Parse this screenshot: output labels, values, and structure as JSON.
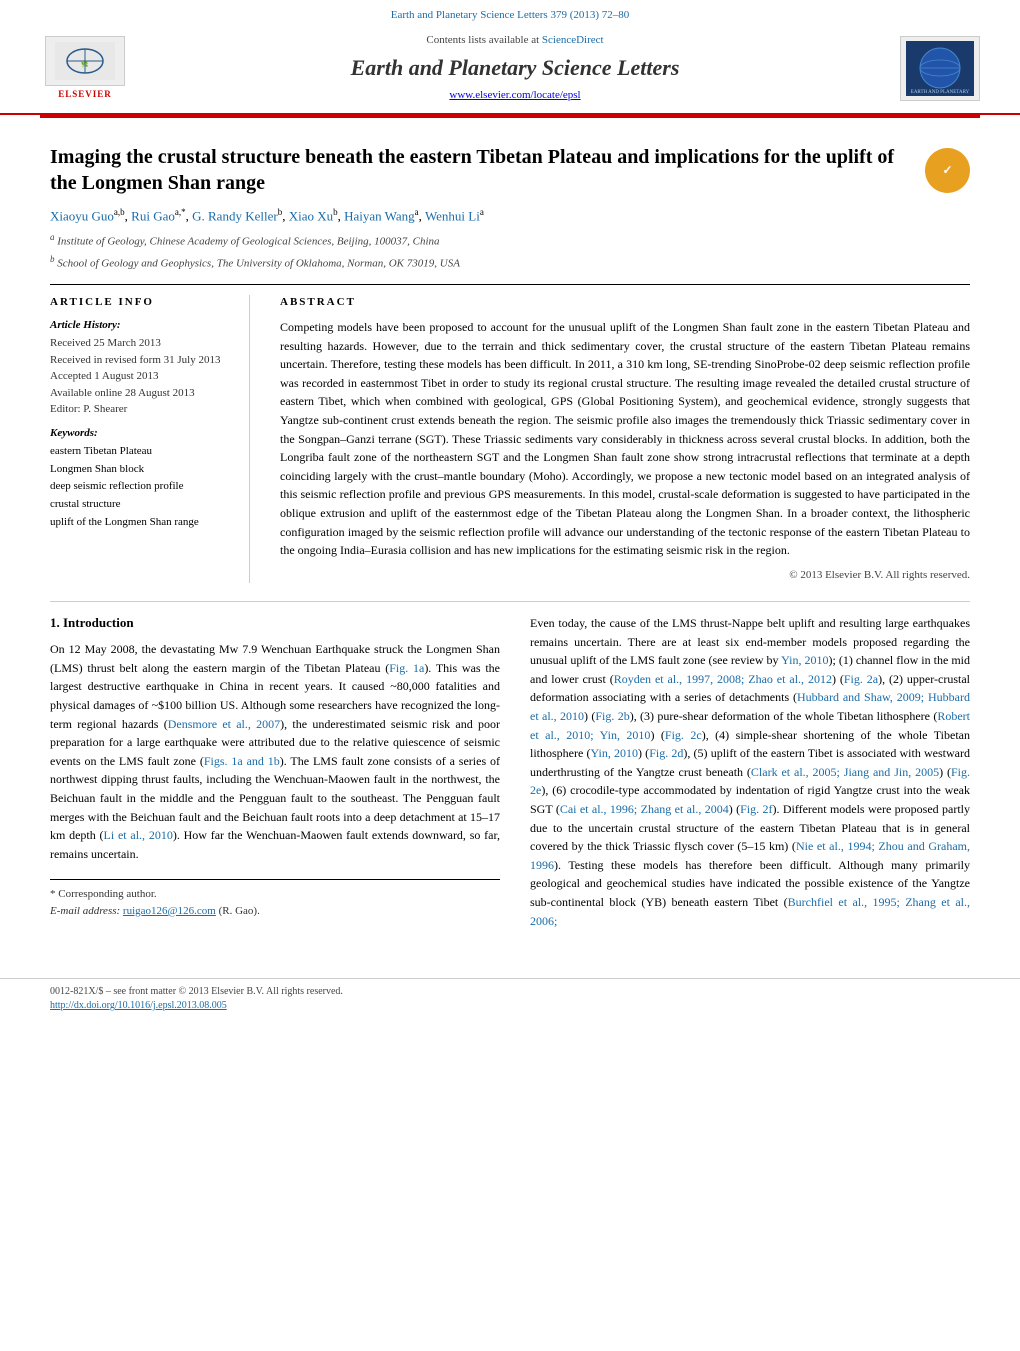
{
  "journal": {
    "top_link_text": "Earth and Planetary Science Letters 379 (2013) 72–80",
    "contents_text": "Contents lists available at",
    "sciencedirect_text": "ScienceDirect",
    "title": "Earth and Planetary Science Letters",
    "url": "www.elsevier.com/locate/epsl",
    "elsevier_label": "ELSEVIER",
    "earth_logo_label": "EARTH AND PLANETARY SCIENCE LETTERS"
  },
  "article": {
    "title": "Imaging the crustal structure beneath the eastern Tibetan Plateau and implications for the uplift of the Longmen Shan range",
    "crossmark_symbol": "✓",
    "authors": [
      {
        "name": "Xiaoyu Guo",
        "sup": "a,b"
      },
      {
        "name": "Rui Gao",
        "sup": "a,*"
      },
      {
        "name": "G. Randy Keller",
        "sup": "b"
      },
      {
        "name": "Xiao Xu",
        "sup": "b"
      },
      {
        "name": "Haiyan Wang",
        "sup": "a"
      },
      {
        "name": "Wenhui Li",
        "sup": "a"
      }
    ],
    "affiliations": [
      {
        "sup": "a",
        "text": "Institute of Geology, Chinese Academy of Geological Sciences, Beijing, 100037, China"
      },
      {
        "sup": "b",
        "text": "School of Geology and Geophysics, The University of Oklahoma, Norman, OK 73019, USA"
      }
    ]
  },
  "article_info": {
    "heading": "ARTICLE INFO",
    "history_label": "Article History:",
    "received": "Received 25 March 2013",
    "revised": "Received in revised form 31 July 2013",
    "accepted": "Accepted 1 August 2013",
    "online": "Available online 28 August 2013",
    "editor_label": "Editor: P. Shearer",
    "keywords_label": "Keywords:",
    "keywords": [
      "eastern Tibetan Plateau",
      "Longmen Shan block",
      "deep seismic reflection profile",
      "crustal structure",
      "uplift of the Longmen Shan range"
    ]
  },
  "abstract": {
    "heading": "ABSTRACT",
    "text": "Competing models have been proposed to account for the unusual uplift of the Longmen Shan fault zone in the eastern Tibetan Plateau and resulting hazards. However, due to the terrain and thick sedimentary cover, the crustal structure of the eastern Tibetan Plateau remains uncertain. Therefore, testing these models has been difficult. In 2011, a 310 km long, SE-trending SinoProbe-02 deep seismic reflection profile was recorded in easternmost Tibet in order to study its regional crustal structure. The resulting image revealed the detailed crustal structure of eastern Tibet, which when combined with geological, GPS (Global Positioning System), and geochemical evidence, strongly suggests that Yangtze sub-continent crust extends beneath the region. The seismic profile also images the tremendously thick Triassic sedimentary cover in the Songpan–Ganzi terrane (SGT). These Triassic sediments vary considerably in thickness across several crustal blocks. In addition, both the Longriba fault zone of the northeastern SGT and the Longmen Shan fault zone show strong intracrustal reflections that terminate at a depth coinciding largely with the crust–mantle boundary (Moho). Accordingly, we propose a new tectonic model based on an integrated analysis of this seismic reflection profile and previous GPS measurements. In this model, crustal-scale deformation is suggested to have participated in the oblique extrusion and uplift of the easternmost edge of the Tibetan Plateau along the Longmen Shan. In a broader context, the lithospheric configuration imaged by the seismic reflection profile will advance our understanding of the tectonic response of the eastern Tibetan Plateau to the ongoing India–Eurasia collision and has new implications for the estimating seismic risk in the region.",
    "copyright": "© 2013 Elsevier B.V. All rights reserved."
  },
  "section1": {
    "heading": "1. Introduction",
    "left_paragraphs": [
      "On 12 May 2008, the devastating Mw 7.9 Wenchuan Earthquake struck the Longmen Shan (LMS) thrust belt along the eastern margin of the Tibetan Plateau (Fig. 1a). This was the largest destructive earthquake in China in recent years. It caused ~80,000 fatalities and physical damages of ~$100 billion US. Although some researchers have recognized the long-term regional hazards (Densmore et al., 2007), the underestimated seismic risk and poor preparation for a large earthquake were attributed due to the relative quiescence of seismic events on the LMS fault zone (Figs. 1a and 1b). The LMS fault zone consists of a series of northwest dipping thrust faults, including the Wenchuan-Maowen fault in the northwest, the Beichuan fault in the middle and the Pengguan fault to the southeast. The Pengguan fault merges with the Beichuan fault and the Beichuan fault roots into a deep detachment at 15–17 km depth (Li et al., 2010). How far the Wenchuan-Maowen fault extends downward, so far, remains uncertain."
    ],
    "right_paragraphs": [
      "Even today, the cause of the LMS thrust-Nappe belt uplift and resulting large earthquakes remains uncertain. There are at least six end-member models proposed regarding the unusual uplift of the LMS fault zone (see review by Yin, 2010); (1) channel flow in the mid and lower crust (Royden et al., 1997, 2008; Zhao et al., 2012) (Fig. 2a), (2) upper-crustal deformation associating with a series of detachments (Hubbard and Shaw, 2009; Hubbard et al., 2010) (Fig. 2b), (3) pure-shear deformation of the whole Tibetan lithosphere (Robert et al., 2010; Yin, 2010) (Fig. 2c), (4) simple-shear shortening of the whole Tibetan lithosphere (Yin, 2010) (Fig. 2d), (5) uplift of the eastern Tibet is associated with westward underthrusting of the Yangtze crust beneath (Clark et al., 2005; Jiang and Jin, 2005) (Fig. 2e), (6) crocodile-type accommodated by indentation of rigid Yangtze crust into the weak SGT (Cai et al., 1996; Zhang et al., 2004) (Fig. 2f). Different models were proposed partly due to the uncertain crustal structure of the eastern Tibetan Plateau that is in general covered by the thick Triassic flysch cover (5–15 km) (Nie et al., 1994; Zhou and Graham, 1996). Testing these models has therefore been difficult. Although many primarily geological and geochemical studies have indicated the possible existence of the Yangtze sub-continental block (YB) beneath eastern Tibet (Burchfiel et al., 1995; Zhang et al., 2006;"
    ]
  },
  "footnote": {
    "star": "* Corresponding author.",
    "email_label": "E-mail address:",
    "email": "ruigao126@126.com",
    "email_note": "(R. Gao)."
  },
  "footer": {
    "issn": "0012-821X/$ – see front matter  © 2013 Elsevier B.V. All rights reserved.",
    "doi_label": "http://dx.doi.org/10.1016/j.epsl.2013.08.005"
  }
}
